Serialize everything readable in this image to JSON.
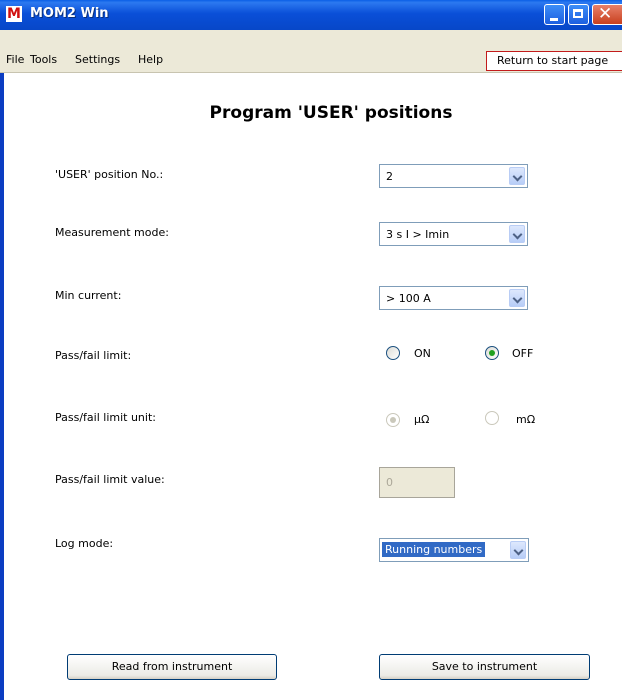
{
  "window": {
    "title": "MOM2 Win",
    "icon_letter": "M",
    "close_glyph": "✕"
  },
  "menu": {
    "items": [
      "File",
      "Tools",
      "Settings",
      "Help"
    ],
    "return_button": "Return to start page"
  },
  "page": {
    "heading": "Program 'USER' positions"
  },
  "form": {
    "user_position": {
      "label": "'USER' position No.:",
      "value": "2"
    },
    "measurement_mode": {
      "label": "Measurement mode:",
      "value": "3  s I > Imin"
    },
    "min_current": {
      "label": "Min current:",
      "value": "> 100 A"
    },
    "pass_fail_limit": {
      "label": "Pass/fail limit:",
      "options": [
        "ON",
        "OFF"
      ],
      "selected": "OFF"
    },
    "pass_fail_unit": {
      "label": "Pass/fail limit unit:",
      "options": [
        "µΩ",
        "mΩ"
      ],
      "selected": "µΩ",
      "enabled": false
    },
    "pass_fail_value": {
      "label": "Pass/fail limit value:",
      "value": "0",
      "enabled": false
    },
    "log_mode": {
      "label": "Log mode:",
      "value": "Running numbers"
    }
  },
  "buttons": {
    "read": "Read from instrument",
    "save": "Save to instrument"
  },
  "colors": {
    "titlebar": "#0a4fd8",
    "selection": "#316ac5",
    "radio_checked": "#21a121",
    "return_border": "#c21b1b"
  }
}
